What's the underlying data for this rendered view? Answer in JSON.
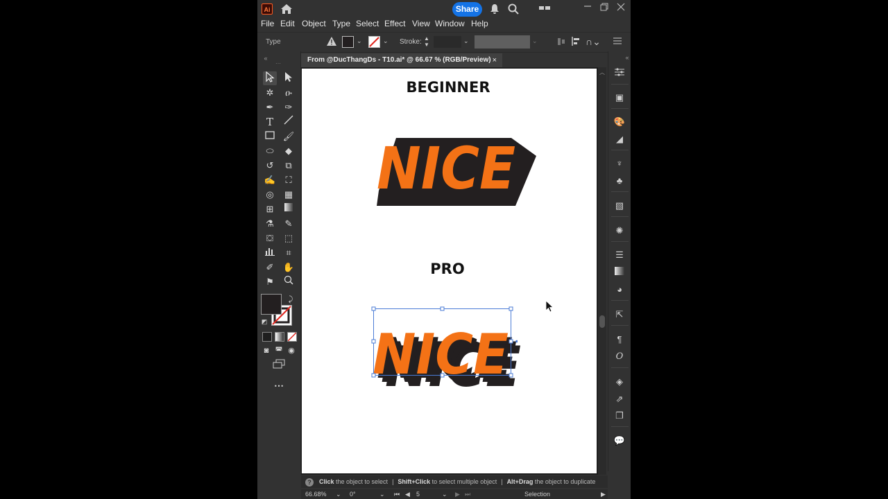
{
  "app": {
    "logo": "Ai",
    "share_label": "Share"
  },
  "menu": [
    "File",
    "Edit",
    "Object",
    "Type",
    "Select",
    "Effect",
    "View",
    "Window",
    "Help"
  ],
  "controlbar": {
    "type_label": "Type",
    "stroke_label": "Stroke:"
  },
  "document": {
    "tab_title": "From @DucThangDs - T10.ai* @ 66.67 % (RGB/Preview)",
    "close": "×"
  },
  "artboard": {
    "heading_beginner": "BEGINNER",
    "heading_pro": "PRO",
    "word": "NICE",
    "colors": {
      "orange": "#f47216",
      "shadow": "#231f20"
    }
  },
  "status": {
    "hint_1_bold": "Click",
    "hint_1": " the object to select",
    "hint_2_bold": "Shift+Click",
    "hint_2": " to select multiple object",
    "hint_3_bold": "Alt+Drag",
    "hint_3": " the object to duplicate"
  },
  "bottom": {
    "zoom": "66.68%",
    "rotation": "0°",
    "artboard_num": "5",
    "tool_name": "Selection"
  },
  "icons": [
    "home-icon",
    "bell-icon",
    "search-icon",
    "minimize-icon",
    "maximize-icon",
    "close-icon"
  ]
}
